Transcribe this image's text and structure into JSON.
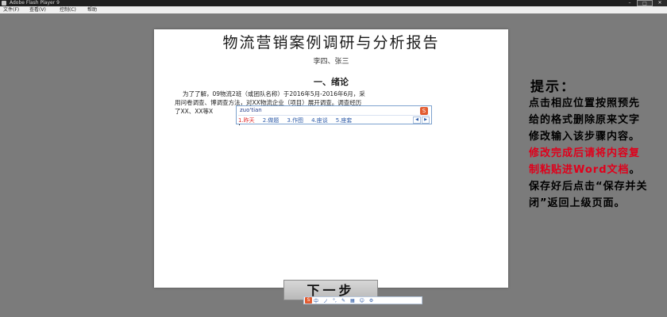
{
  "window": {
    "title": "Adobe Flash Player 9",
    "controls": {
      "minimize": "–",
      "maximize": "□",
      "close": "✕"
    }
  },
  "menu": [
    "文件(F)",
    "查看(V)",
    "控制(C)",
    "帮助"
  ],
  "document": {
    "title": "物流营销案例调研与分析报告",
    "authors": "李四、张三",
    "section_heading": "一、绪论",
    "paragraph_lines": [
      "为了了解，09物流2班（或团队名称）于2016年5月-2016年6月，采",
      "用问卷调查、博调查方法，对XX物流企业（项目）展开调查。调查经历",
      "了XX、XX等X"
    ]
  },
  "ime_popup": {
    "pinyin": "zuo'tian",
    "logo": "S",
    "candidates": [
      "1.昨天",
      "2.做题",
      "3.作图",
      "4.座谈",
      "5.座套"
    ],
    "pager": {
      "prev": "◀",
      "next": "▶"
    }
  },
  "hint": {
    "title": "提示：",
    "body_normal_1": "点击相应位置按照预先给的格式删除原来文字修改输入该步骤内容。",
    "body_red": "修改完成后请将内容复制粘贴进Word文档",
    "body_normal_2": "。保存好后点击“保存并关闭”返回上级页面。"
  },
  "buttons": {
    "next": "下一步"
  },
  "ime_status": {
    "logo": "S",
    "items": [
      "中",
      "ノ",
      "°,",
      "✎",
      "▦",
      "☺",
      "⚙"
    ]
  }
}
